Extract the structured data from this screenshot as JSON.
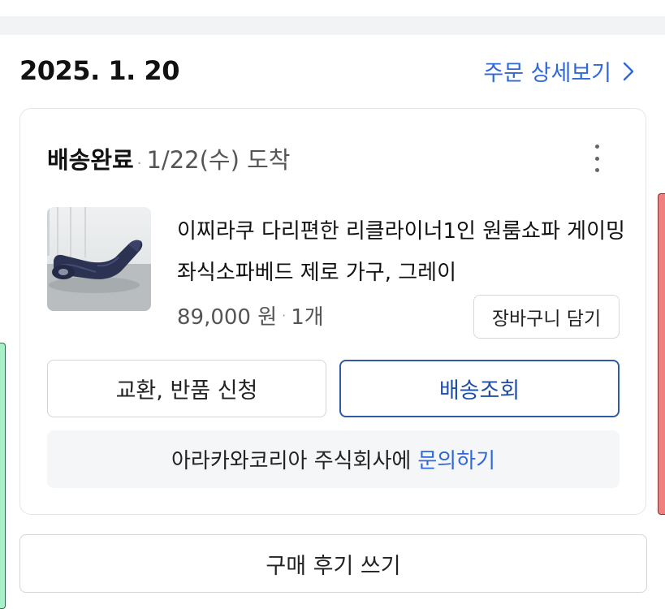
{
  "order": {
    "date": "2025. 1. 20",
    "detail_link": "주문 상세보기"
  },
  "card": {
    "status": "배송완료",
    "arrival": "1/22(수) 도착",
    "product_name": "이찌라쿠 다리편한 리클라이너1인 원룸쇼파 게이밍 좌식소파베드 제로 가구, 그레이",
    "price": "89,000 원",
    "quantity": "1개",
    "cart_button": "장바구니 담기",
    "exchange_button": "교환, 반품 신청",
    "track_button": "배송조회",
    "inquiry_text": "아라카와코리아 주식회사에",
    "inquiry_link": "문의하기"
  },
  "review_button": "구매 후기 쓰기",
  "colors": {
    "link_blue": "#2f68d8",
    "track_border": "#2e5aa8",
    "panel_gray": "#f5f6f8"
  },
  "icons": [
    "chevron-right-icon",
    "more-vertical-icon"
  ]
}
